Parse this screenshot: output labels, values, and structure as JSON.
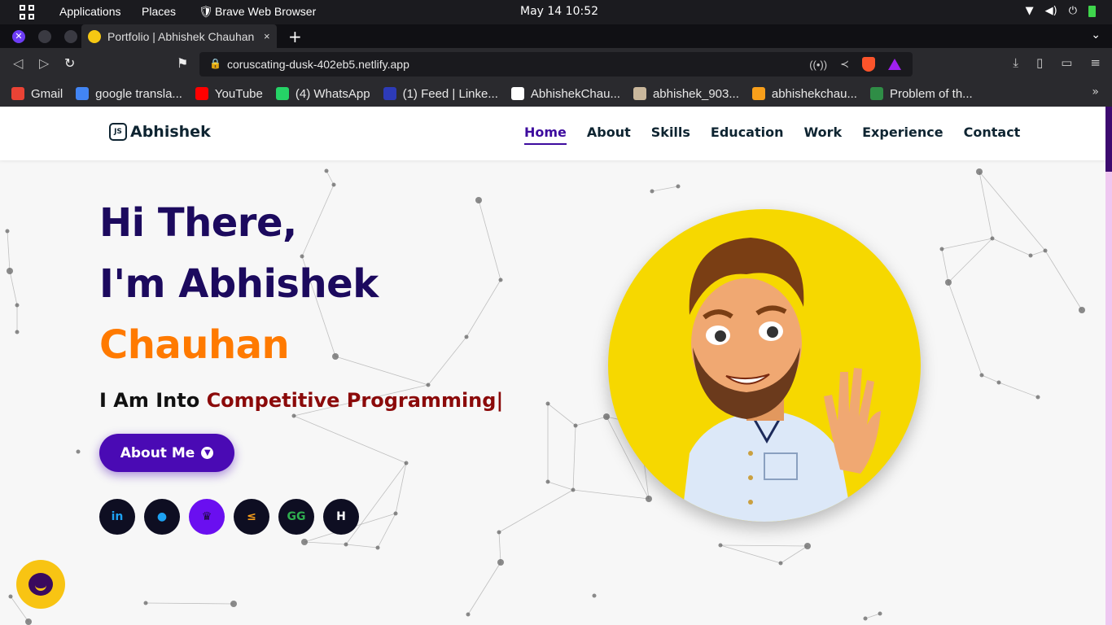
{
  "system_bar": {
    "applications": "Applications",
    "places": "Places",
    "active_app": "Brave Web Browser",
    "clock": "May 14  10:52"
  },
  "browser": {
    "tab_title": "Portfolio | Abhishek Chauhan",
    "tab_close": "×",
    "new_tab": "+",
    "url": "coruscating-dusk-402eb5.netlify.app",
    "bookmarks": [
      {
        "label": "Gmail",
        "icon": "gmail-icon",
        "color": "#ea4335"
      },
      {
        "label": "google transla...",
        "icon": "google-icon",
        "color": "#4285f4"
      },
      {
        "label": "YouTube",
        "icon": "youtube-icon",
        "color": "#ff0000"
      },
      {
        "label": "(4) WhatsApp",
        "icon": "whatsapp-icon",
        "color": "#25d366"
      },
      {
        "label": "(1) Feed | Linke...",
        "icon": "linkedin-icon",
        "color": "#2d3bb8"
      },
      {
        "label": "AbhishekChau...",
        "icon": "github-icon",
        "color": "#ffffff"
      },
      {
        "label": "abhishek_903...",
        "icon": "codechef-icon",
        "color": "#c9b79c"
      },
      {
        "label": "abhishekchau...",
        "icon": "leetcode-icon",
        "color": "#f89f1b"
      },
      {
        "label": "Problem of th...",
        "icon": "geeksforgeeks-icon",
        "color": "#2f8d46"
      }
    ]
  },
  "site": {
    "logo": "Abhishek",
    "logo_badge": "JS",
    "nav": [
      "Home",
      "About",
      "Skills",
      "Education",
      "Work",
      "Experience",
      "Contact"
    ],
    "hero": {
      "line1": "Hi There,",
      "line2": "I'm Abhishek",
      "line3": "Chauhan",
      "typed_prefix": "I Am Into ",
      "typed_highlight": "Competitive Programming|",
      "button": "About Me"
    },
    "socials": [
      {
        "name": "linkedin-icon",
        "glyph": "in",
        "bg": "#0e0e22",
        "fg": "#1da1f2"
      },
      {
        "name": "github-icon",
        "glyph": "●",
        "bg": "#0e0e22",
        "fg": "#1da1f2"
      },
      {
        "name": "codechef-icon",
        "glyph": "♛",
        "bg": "#6a0ff0",
        "fg": "#1a0a3a"
      },
      {
        "name": "leetcode-icon",
        "glyph": "≤",
        "bg": "#0e0e22",
        "fg": "#f89f1b"
      },
      {
        "name": "geeksforgeeks-icon",
        "glyph": "GG",
        "bg": "#0e0e22",
        "fg": "#2fae4e"
      },
      {
        "name": "hackerrank-icon",
        "glyph": "H",
        "bg": "#0e0e22",
        "fg": "#ffffff"
      }
    ],
    "colors": {
      "primary": "#1c0a5e",
      "accent_orange": "#ff7a00",
      "typed_red": "#8b0a0a",
      "button": "#4a0ab4",
      "avatar_bg": "#f6d800"
    }
  }
}
